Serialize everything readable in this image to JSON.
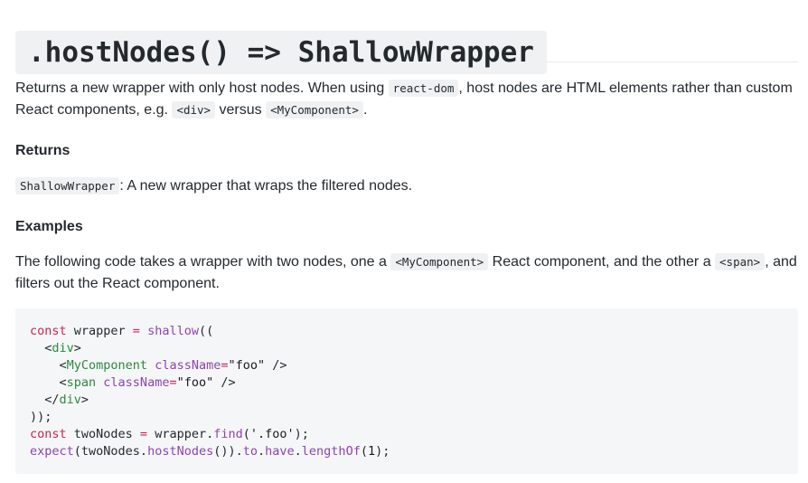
{
  "title": ".hostNodes() => ShallowWrapper",
  "intro": {
    "text1": "Returns a new wrapper with only host nodes. When using ",
    "code1": "react-dom",
    "text2": ", host nodes are HTML elements rather than custom React components, e.g. ",
    "code2": "<div>",
    "text3": " versus ",
    "code3": "<MyComponent>",
    "text4": "."
  },
  "returns": {
    "heading": "Returns",
    "code": "ShallowWrapper",
    "text": ": A new wrapper that wraps the filtered nodes."
  },
  "examples": {
    "heading": "Examples",
    "text1": "The following code takes a wrapper with two nodes, one a ",
    "code1": "<MyComponent>",
    "text2": " React component, and the other a ",
    "code2": "<span>",
    "text3": ", and filters out the React component."
  },
  "code_lines": [
    [
      {
        "t": "const",
        "k": "keyword"
      },
      {
        "t": " wrapper ",
        "k": "punct"
      },
      {
        "t": "=",
        "k": "keyword"
      },
      {
        "t": " ",
        "k": "punct"
      },
      {
        "t": "shallow",
        "k": "func"
      },
      {
        "t": "((",
        "k": "punct"
      }
    ],
    [
      {
        "t": "  <",
        "k": "punct"
      },
      {
        "t": "div",
        "k": "tag"
      },
      {
        "t": ">",
        "k": "punct"
      }
    ],
    [
      {
        "t": "    <",
        "k": "punct"
      },
      {
        "t": "MyComponent",
        "k": "tag"
      },
      {
        "t": " ",
        "k": "punct"
      },
      {
        "t": "className",
        "k": "attr"
      },
      {
        "t": "=",
        "k": "keyword"
      },
      {
        "t": "\"foo\"",
        "k": "string"
      },
      {
        "t": " />",
        "k": "punct"
      }
    ],
    [
      {
        "t": "    <",
        "k": "punct"
      },
      {
        "t": "span",
        "k": "tag"
      },
      {
        "t": " ",
        "k": "punct"
      },
      {
        "t": "className",
        "k": "attr"
      },
      {
        "t": "=",
        "k": "keyword"
      },
      {
        "t": "\"foo\"",
        "k": "string"
      },
      {
        "t": " />",
        "k": "punct"
      }
    ],
    [
      {
        "t": "  </",
        "k": "punct"
      },
      {
        "t": "div",
        "k": "tag"
      },
      {
        "t": ">",
        "k": "punct"
      }
    ],
    [
      {
        "t": "));",
        "k": "punct"
      }
    ],
    [
      {
        "t": "const",
        "k": "keyword"
      },
      {
        "t": " twoNodes ",
        "k": "punct"
      },
      {
        "t": "=",
        "k": "keyword"
      },
      {
        "t": " wrapper.",
        "k": "punct"
      },
      {
        "t": "find",
        "k": "func"
      },
      {
        "t": "(",
        "k": "punct"
      },
      {
        "t": "'.foo'",
        "k": "string"
      },
      {
        "t": ");",
        "k": "punct"
      }
    ],
    [
      {
        "t": "expect",
        "k": "func"
      },
      {
        "t": "(twoNodes.",
        "k": "punct"
      },
      {
        "t": "hostNodes",
        "k": "func"
      },
      {
        "t": "()).",
        "k": "punct"
      },
      {
        "t": "to",
        "k": "prop"
      },
      {
        "t": ".",
        "k": "punct"
      },
      {
        "t": "have",
        "k": "prop"
      },
      {
        "t": ".",
        "k": "punct"
      },
      {
        "t": "lengthOf",
        "k": "func"
      },
      {
        "t": "(",
        "k": "punct"
      },
      {
        "t": "1",
        "k": "number"
      },
      {
        "t": ");",
        "k": "punct"
      }
    ]
  ]
}
